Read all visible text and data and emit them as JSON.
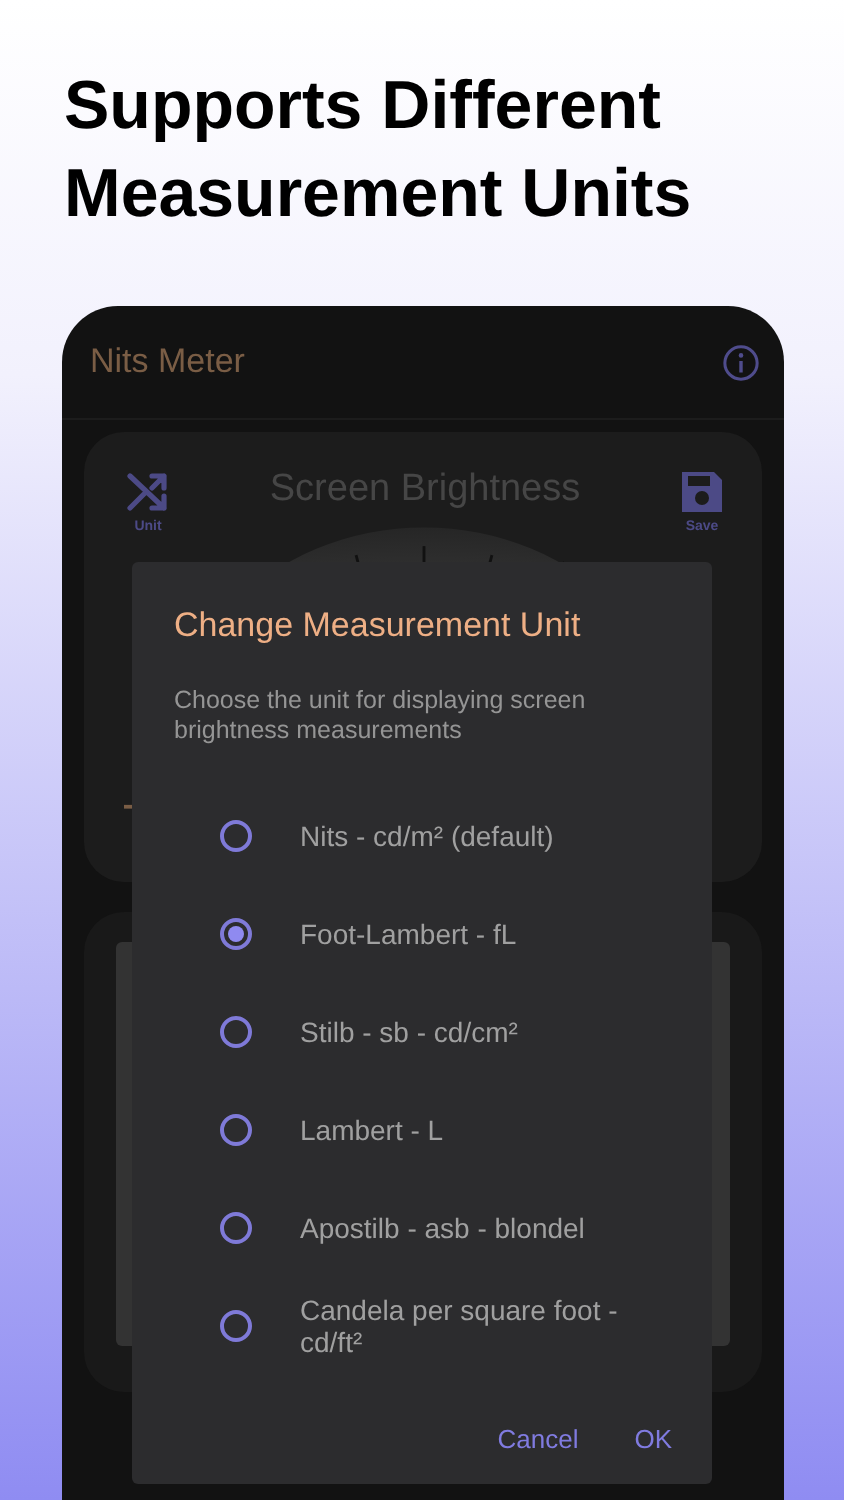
{
  "headline": "Supports Different Measurement Units",
  "app": {
    "title": "Nits Meter"
  },
  "card": {
    "title": "Screen Brightness",
    "actions": [
      {
        "label": "Unit",
        "kind": "shuffle"
      },
      {
        "label": "Save",
        "kind": "save"
      }
    ]
  },
  "dialog": {
    "title": "Change Measurement Unit",
    "description": "Choose the unit for displaying screen brightness measurements",
    "options": [
      {
        "label": "Nits - cd/m² (default)",
        "selected": false
      },
      {
        "label": "Foot-Lambert - fL",
        "selected": true
      },
      {
        "label": "Stilb - sb - cd/cm²",
        "selected": false
      },
      {
        "label": "Lambert - L",
        "selected": false
      },
      {
        "label": "Apostilb - asb - blondel",
        "selected": false
      },
      {
        "label": "Candela per square foot - cd/ft²",
        "selected": false
      }
    ],
    "buttons": [
      "Cancel",
      "OK"
    ]
  }
}
